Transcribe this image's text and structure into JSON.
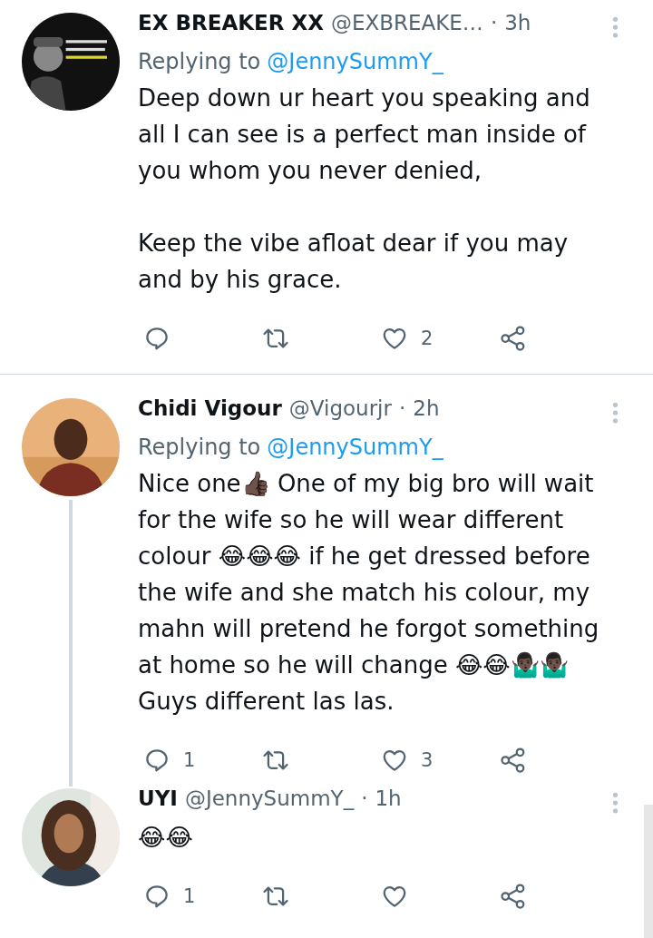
{
  "tweets": [
    {
      "name": "EX BREAKER XX",
      "handle": "@EXBREAKE…",
      "dot": "·",
      "time": "3h",
      "replying_label": "Replying to",
      "replying_handle": "@JennySummY_",
      "paragraphs": [
        "Deep down ur heart you speaking and all I can see is a perfect man inside of you whom you never denied,",
        "Keep the vibe afloat dear if you may and by his grace."
      ],
      "like_count": "2",
      "thread_line": false
    },
    {
      "name": "Chidi Vigour",
      "handle": "@Vigourjr",
      "dot": "·",
      "time": "2h",
      "replying_label": "Replying to",
      "replying_handle": "@JennySummY_",
      "paragraphs": [
        "Nice one👍🏿 One of my big bro will wait for the wife so he will wear different colour 😂😂😂 if he get dressed before the wife and she match his colour, my mahn will pretend he forgot something at home so he will change 😂😂🤷🏿‍♂️🤷🏿‍♂️ Guys different las las."
      ],
      "reply_count": "1",
      "like_count": "3",
      "thread_line": true
    },
    {
      "name": "UYI",
      "handle": "@JennySummY_",
      "dot": "·",
      "time": "1h",
      "paragraphs": [
        "😂😂"
      ],
      "reply_count": "1",
      "thread_line": false
    }
  ]
}
